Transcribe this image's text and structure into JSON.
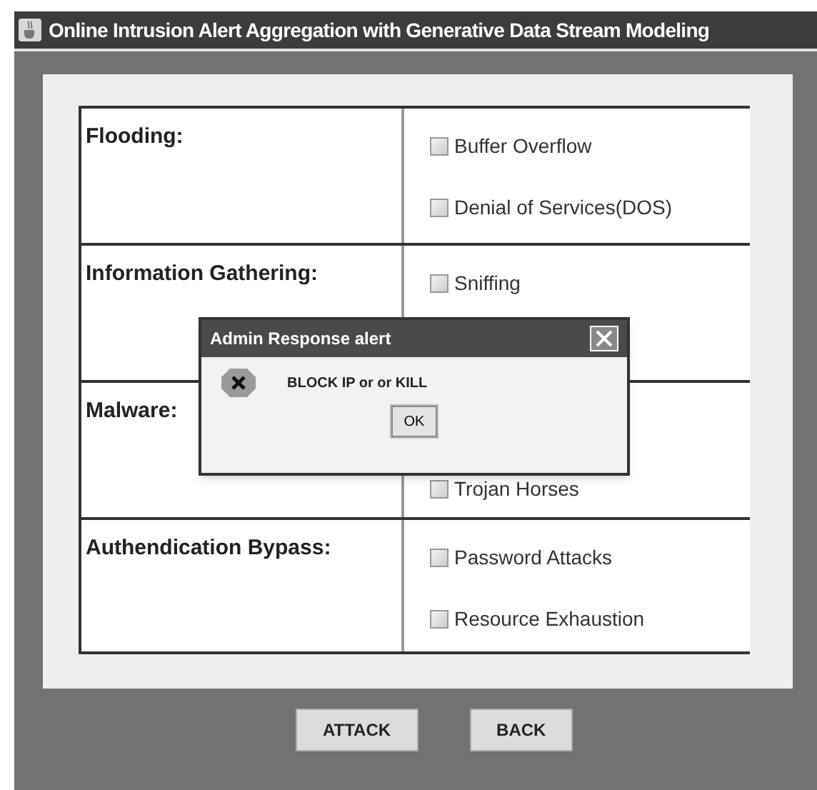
{
  "window": {
    "title": "Online Intrusion Alert Aggregation with Generative Data Stream Modeling"
  },
  "categories": [
    {
      "label": "Flooding:",
      "options": [
        {
          "label": "Buffer Overflow",
          "checked": false
        },
        {
          "label": "Denial of Services(DOS)",
          "checked": false
        }
      ]
    },
    {
      "label": "Information Gathering:",
      "options": [
        {
          "label": "Sniffing",
          "checked": false
        }
      ]
    },
    {
      "label": "Malware:",
      "options": [
        {
          "label": "Trojan Horses",
          "checked": false
        }
      ]
    },
    {
      "label": "Authendication Bypass:",
      "options": [
        {
          "label": "Password Attacks",
          "checked": false
        },
        {
          "label": "Resource Exhaustion",
          "checked": false
        }
      ]
    }
  ],
  "buttons": [
    "ATTACK",
    "BACK"
  ],
  "dialog": {
    "title": "Admin Response alert",
    "message": "BLOCK IP or or KILL",
    "button": "OK"
  }
}
